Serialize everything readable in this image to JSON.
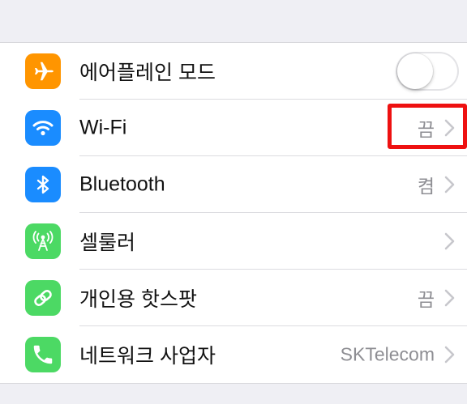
{
  "settings": {
    "rows": [
      {
        "key": "airplane",
        "label": "에어플레인 모드",
        "value": "",
        "icon": "airplane-icon",
        "color": "#ff9500",
        "toggle": "off"
      },
      {
        "key": "wifi",
        "label": "Wi-Fi",
        "value": "끔",
        "icon": "wifi-icon",
        "color": "#1a8cff"
      },
      {
        "key": "bluetooth",
        "label": "Bluetooth",
        "value": "켬",
        "icon": "bluetooth-icon",
        "color": "#1a8cff"
      },
      {
        "key": "cellular",
        "label": "셀룰러",
        "value": "",
        "icon": "antenna-icon",
        "color": "#4cd964"
      },
      {
        "key": "hotspot",
        "label": "개인용 핫스팟",
        "value": "끔",
        "icon": "chain-link-icon",
        "color": "#4cd964"
      },
      {
        "key": "carrier",
        "label": "네트워크 사업자",
        "value": "SKTelecom",
        "icon": "phone-icon",
        "color": "#4cd964"
      }
    ]
  },
  "highlight": {
    "color": "#ee1111",
    "target": "wifi-value"
  }
}
